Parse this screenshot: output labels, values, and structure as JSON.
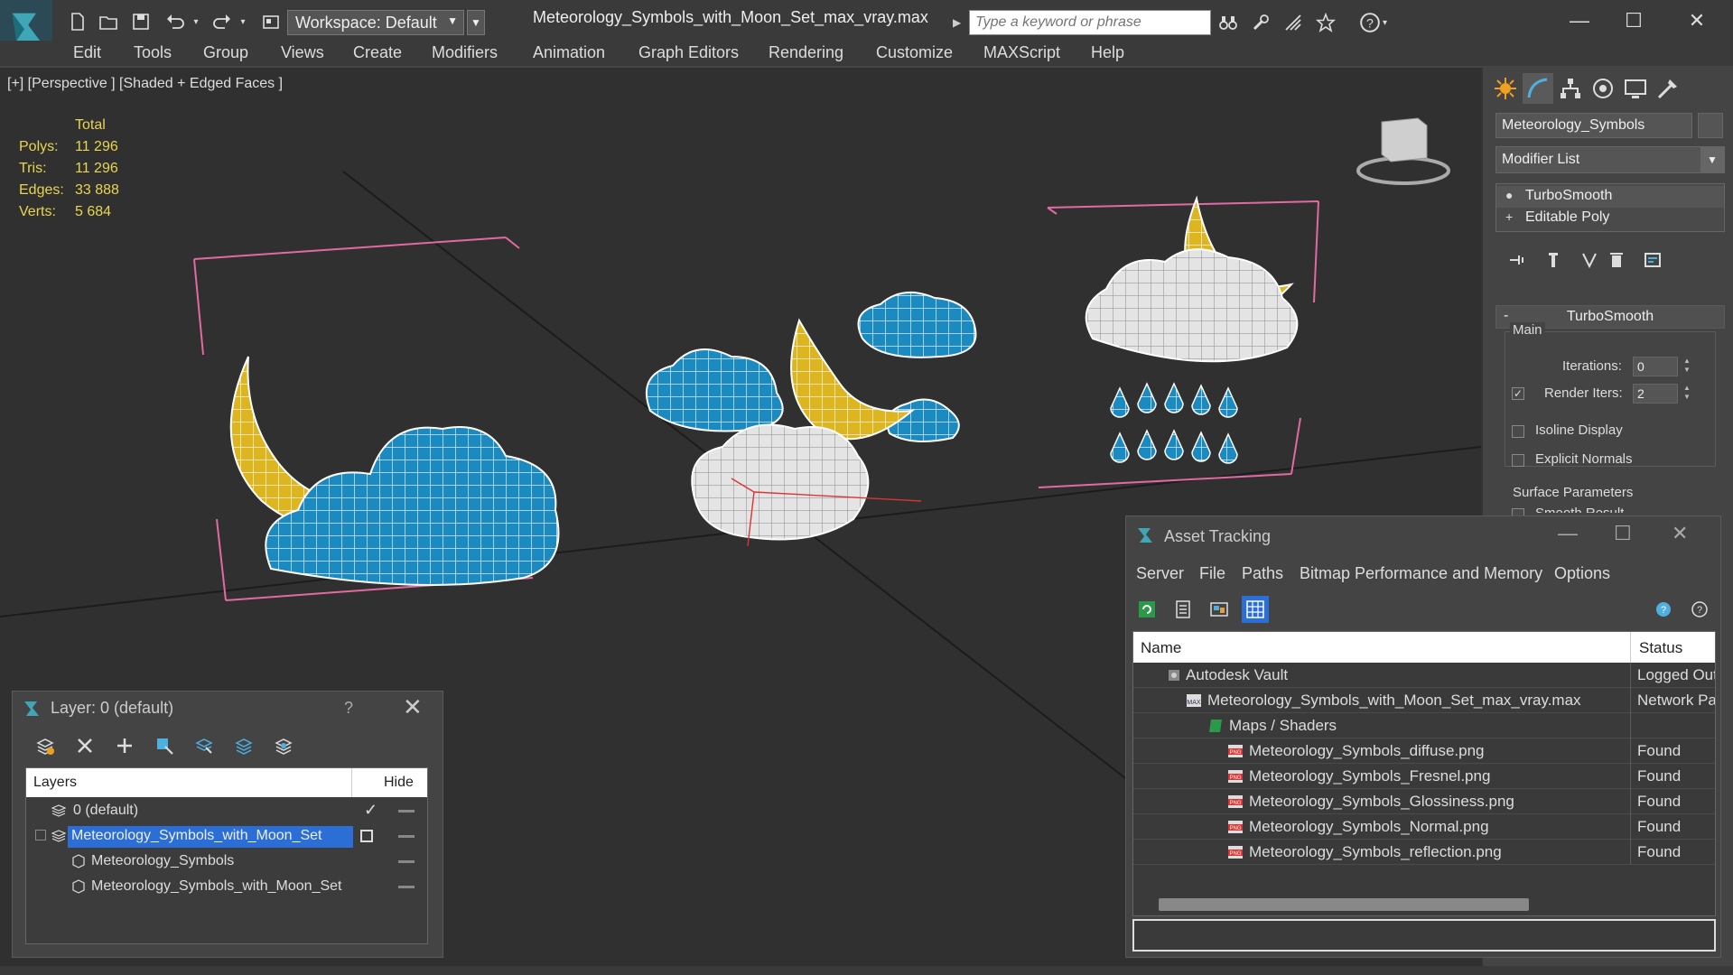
{
  "titlebar": {
    "workspace_label": "Workspace: Default",
    "file_title": "Meteorology_Symbols_with_Moon_Set_max_vray.max",
    "search_placeholder": "Type a keyword or phrase",
    "icons": [
      "new-file-icon",
      "open-folder-icon",
      "save-icon",
      "undo-icon",
      "redo-icon",
      "project-icon",
      "binoculars-icon",
      "tools-icon",
      "signal-icon",
      "star-icon",
      "help-icon"
    ],
    "window_controls": {
      "minimize": "—",
      "maximize": "☐",
      "close": "✕"
    }
  },
  "menubar": {
    "items": [
      "Edit",
      "Tools",
      "Group",
      "Views",
      "Create",
      "Modifiers",
      "Animation",
      "Graph Editors",
      "Rendering",
      "Customize",
      "MAXScript",
      "Help"
    ]
  },
  "viewport": {
    "label": "[+] [Perspective ] [Shaded + Edged Faces ]",
    "stats": {
      "header": "Total",
      "rows": [
        {
          "label": "Polys:",
          "value": "11 296"
        },
        {
          "label": "Tris:",
          "value": "11 296"
        },
        {
          "label": "Edges:",
          "value": "33 888"
        },
        {
          "label": "Verts:",
          "value": "5 684"
        }
      ]
    },
    "colors": {
      "background": "#303030",
      "cloud_blue": "#1b8ac0",
      "moon_yellow": "#e0b820",
      "cloud_white": "#e8e8e8",
      "wire": "#ffffff",
      "bbox": "#e26aa2"
    }
  },
  "command_panel": {
    "object_name": "Meteorology_Symbols",
    "modifier_list": "Modifier List",
    "stack": [
      "TurboSmooth",
      "Editable Poly"
    ],
    "turbosmooth": {
      "title": "TurboSmooth",
      "main_label": "Main",
      "iterations_label": "Iterations:",
      "iterations_value": "0",
      "render_iters_label": "Render Iters:",
      "render_iters_value": "2",
      "render_iters_checked": "✓",
      "isoline_label": "Isoline Display",
      "explicit_normals_label": "Explicit Normals",
      "surface_params_label": "Surface Parameters",
      "smooth_result_label": "Smooth Result"
    }
  },
  "layer_dialog": {
    "title": "Layer: 0 (default)",
    "help": "?",
    "close": "✕",
    "col_layers": "Layers",
    "col_hide": "Hide",
    "rows": [
      {
        "name": "0 (default)",
        "indent": 1,
        "check": "✓"
      },
      {
        "name": "Meteorology_Symbols_with_Moon_Set",
        "indent": 1,
        "selected": true
      },
      {
        "name": "Meteorology_Symbols",
        "indent": 2
      },
      {
        "name": "Meteorology_Symbols_with_Moon_Set",
        "indent": 2
      }
    ]
  },
  "asset_dialog": {
    "title": "Asset Tracking",
    "menu": [
      "Server",
      "File",
      "Paths",
      "Bitmap Performance and Memory",
      "Options"
    ],
    "col_name": "Name",
    "col_status": "Status",
    "rows": [
      {
        "name": "Autodesk Vault",
        "status": "Logged Out",
        "icon": "vault-icon"
      },
      {
        "name": "Meteorology_Symbols_with_Moon_Set_max_vray.max",
        "status": "Network Path",
        "icon": "max-file-icon"
      },
      {
        "name": "Maps / Shaders",
        "status": "",
        "icon": "maps-folder-icon"
      },
      {
        "name": "Meteorology_Symbols_diffuse.png",
        "status": "Found",
        "icon": "png-icon"
      },
      {
        "name": "Meteorology_Symbols_Fresnel.png",
        "status": "Found",
        "icon": "png-icon"
      },
      {
        "name": "Meteorology_Symbols_Glossiness.png",
        "status": "Found",
        "icon": "png-icon"
      },
      {
        "name": "Meteorology_Symbols_Normal.png",
        "status": "Found",
        "icon": "png-icon"
      },
      {
        "name": "Meteorology_Symbols_reflection.png",
        "status": "Found",
        "icon": "png-icon"
      }
    ],
    "window_controls": {
      "minimize": "—",
      "maximize": "☐",
      "close": "✕"
    }
  }
}
